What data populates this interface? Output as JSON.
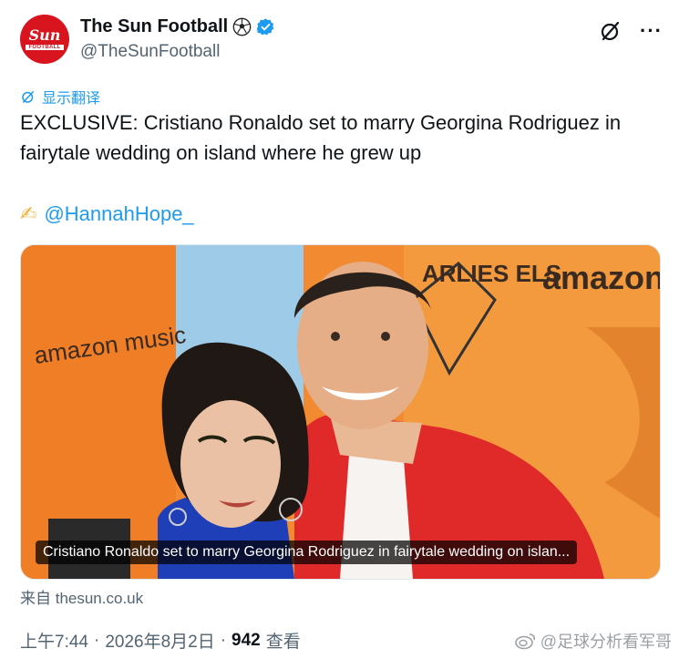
{
  "account": {
    "display_name": "The Sun Football",
    "handle": "@TheSunFootball",
    "avatar_logo": "Sun",
    "avatar_sub": "FOOTBALL"
  },
  "translate_label": "显示翻译",
  "tweet": {
    "text": "EXCLUSIVE: Cristiano Ronaldo set to marry Georgina Rodriguez in fairytale wedding on island where he grew up",
    "credit_mention": "@HannahHope_"
  },
  "card": {
    "caption": "Cristiano Ronaldo set to marry Georgina Rodriguez in fairytale wedding on islan...",
    "backdrop_text_left": "amazon music",
    "backdrop_text_right": "amazon",
    "backdrop_text_sign": "ARLIES ELS",
    "source": "来自 thesun.co.uk"
  },
  "meta": {
    "time": "上午7:44",
    "date": "2026年8月2日",
    "views": "942",
    "views_label": "查看",
    "separator": "·"
  },
  "watermark": "@足球分析看军哥",
  "colors": {
    "accent": "#1d9bf0",
    "brand_red": "#d8141f",
    "orange_backdrop": "#f08a2c",
    "jacket_red": "#e02a2a"
  },
  "icons": {
    "header": [
      "soccer-ball-icon",
      "verified-badge-icon",
      "grok-icon",
      "more-icon"
    ],
    "translate": "translate-icon",
    "credit": "writing-hand-icon"
  }
}
